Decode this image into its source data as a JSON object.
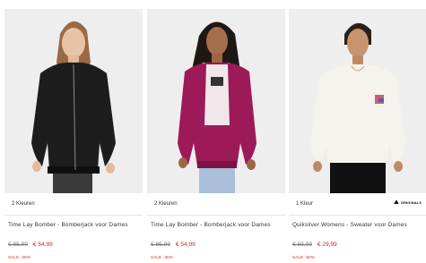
{
  "products": [
    {
      "colors": "2 Kleuren",
      "title": "Time Lay Bomber - Bomberjack voor Dames",
      "old_price": "€ 85,99",
      "new_price": "€ 54,99",
      "sale": "SALE -36%",
      "image_icon": "black-bomber-jacket-photo"
    },
    {
      "colors": "2 Kleuren",
      "title": "Time Lay Bomber - Bomberjack voor Dames",
      "old_price": "€ 85,99",
      "new_price": "€ 54,99",
      "sale": "SALE -36%",
      "image_icon": "magenta-bomber-jacket-photo"
    },
    {
      "colors": "1 Kleur",
      "title": "Quiksilver Womens - Sweater voor Dames",
      "old_price": "€ 59,99",
      "new_price": "€ 29,99",
      "sale": "SALE -50%",
      "image_icon": "white-sweater-photo",
      "brand_logo": "ORIGINALS"
    }
  ],
  "colors": {
    "sale_red": "#d0261d",
    "photo_bg": "#eeeeee"
  }
}
